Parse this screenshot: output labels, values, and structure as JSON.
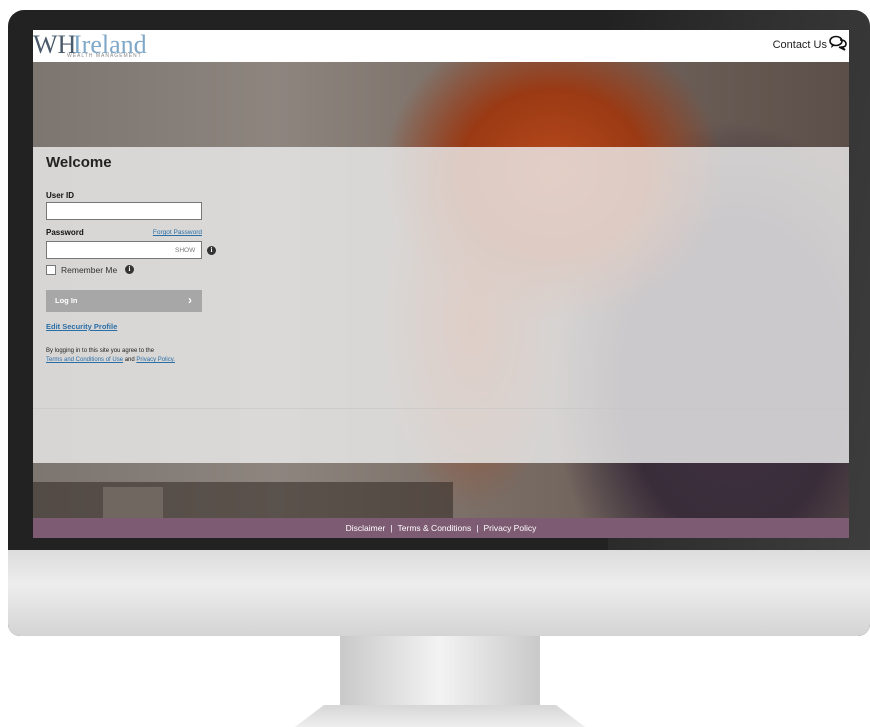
{
  "header": {
    "logo_main": "WH",
    "logo_accent": "Ireland",
    "logo_tagline": "WEALTH MANAGEMENT",
    "contact_label": "Contact Us",
    "contact_icon": "chat-bubbles-icon"
  },
  "login": {
    "title": "Welcome",
    "userid_label": "User ID",
    "userid_value": "",
    "password_label": "Password",
    "forgot_password": "Forgot Password",
    "password_value": "",
    "show_label": "SHOW",
    "remember_label": "Remember Me",
    "info_icon": "info-icon",
    "login_button": "Log In",
    "login_arrow": "›",
    "edit_security": "Edit Security Profile",
    "agree_text": "By logging in to this site you agree to the",
    "terms_link": "Terms and Conditions of Use",
    "and_text": " and ",
    "privacy_link": "Privacy Policy."
  },
  "footer": {
    "disclaimer": "Disclaimer",
    "terms": "Terms & Conditions",
    "privacy": "Privacy Policy",
    "separator": "|"
  },
  "colors": {
    "footer_bg": "#7d5b73",
    "link": "#2a6ea6",
    "button_bg": "#a7a7a7"
  }
}
